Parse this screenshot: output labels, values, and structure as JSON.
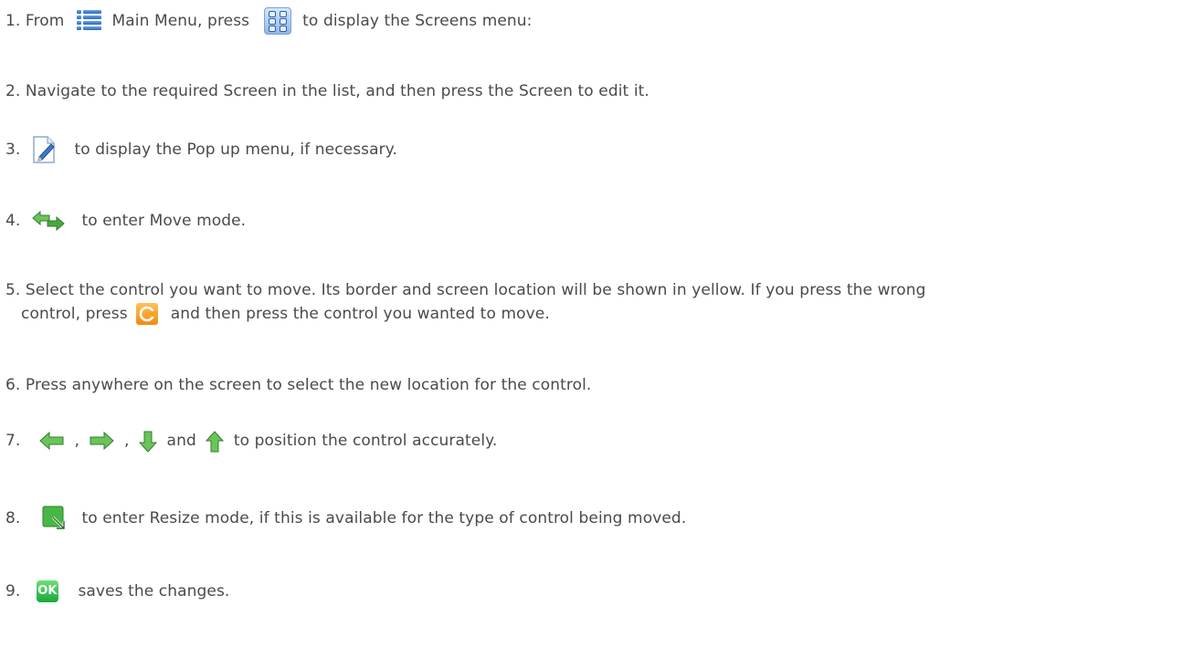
{
  "steps": {
    "s1": {
      "a": "1. From",
      "b": "Main Menu, press",
      "c": "to display the Screens menu:"
    },
    "s2": "2. Navigate to the required Screen in the list, and then press the Screen to edit it.",
    "s3": {
      "a": "3.",
      "b": "to display the Pop up menu, if necessary."
    },
    "s4": {
      "a": "4.",
      "b": "to enter Move mode."
    },
    "s5": {
      "line1": "5. Select the control you want to move. Its border and screen location will be shown in  yellow. If you press the wrong",
      "a": "control, press",
      "b": "and then press the control you wanted to move."
    },
    "s6": "6. Press anywhere on the screen to select the new location for the control.",
    "s7": {
      "a": "7.",
      "c1": ",",
      "c2": ",",
      "and": "and",
      "b": "to position the control accurately."
    },
    "s8": {
      "a": "8.",
      "b": "to enter Resize mode, if this is available for the type of control being moved."
    },
    "s9": {
      "a": "9.",
      "ok": "OK",
      "b": "saves the changes."
    }
  },
  "icons": {
    "main_menu": "main-menu-icon",
    "screens": "screens-icon",
    "edit": "edit-icon",
    "move": "move-mode-icon",
    "clear": "clear-icon",
    "left": "left-arrow-icon",
    "right": "right-arrow-icon",
    "down": "down-arrow-icon",
    "up": "up-arrow-icon",
    "resize": "resize-icon",
    "ok": "ok-icon"
  },
  "colors": {
    "text": "#4a4a4a",
    "menu_blue": "#2a66b8",
    "clear_orange": "#f08a12",
    "arrow_green": "#2e9e2e",
    "ok_green": "#16a83a"
  }
}
